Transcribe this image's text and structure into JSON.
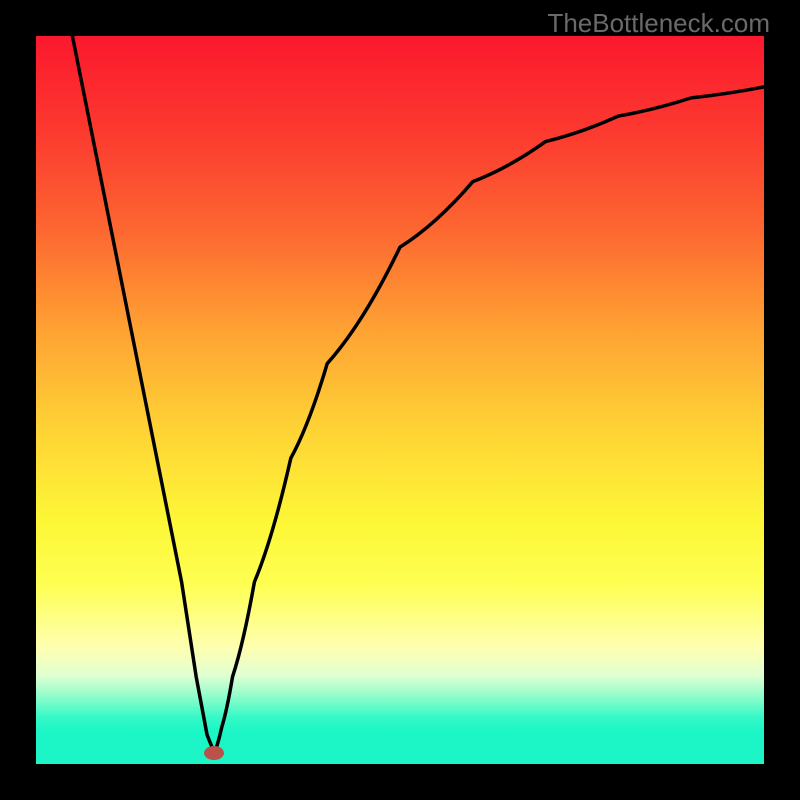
{
  "watermark": "TheBottleneck.com",
  "chart_data": {
    "type": "line",
    "title": "",
    "xlabel": "",
    "ylabel": "",
    "xlim": [
      0,
      100
    ],
    "ylim": [
      0,
      100
    ],
    "series": [
      {
        "name": "curve",
        "points": [
          {
            "x": 5.0,
            "y": 100.0
          },
          {
            "x": 20.0,
            "y": 25.0
          },
          {
            "x": 22.0,
            "y": 12.0
          },
          {
            "x": 23.5,
            "y": 4.0
          },
          {
            "x": 24.5,
            "y": 1.5
          },
          {
            "x": 25.5,
            "y": 5.0
          },
          {
            "x": 27.0,
            "y": 12.0
          },
          {
            "x": 30.0,
            "y": 25.0
          },
          {
            "x": 35.0,
            "y": 42.0
          },
          {
            "x": 40.0,
            "y": 55.0
          },
          {
            "x": 50.0,
            "y": 71.0
          },
          {
            "x": 60.0,
            "y": 80.0
          },
          {
            "x": 70.0,
            "y": 85.5
          },
          {
            "x": 80.0,
            "y": 89.0
          },
          {
            "x": 90.0,
            "y": 91.5
          },
          {
            "x": 100.0,
            "y": 93.0
          }
        ]
      }
    ],
    "marker": {
      "x": 24.5,
      "y": 1.5
    },
    "gradient_colors": {
      "top": "#fb182e",
      "bottom": "#1cf6c6"
    }
  }
}
